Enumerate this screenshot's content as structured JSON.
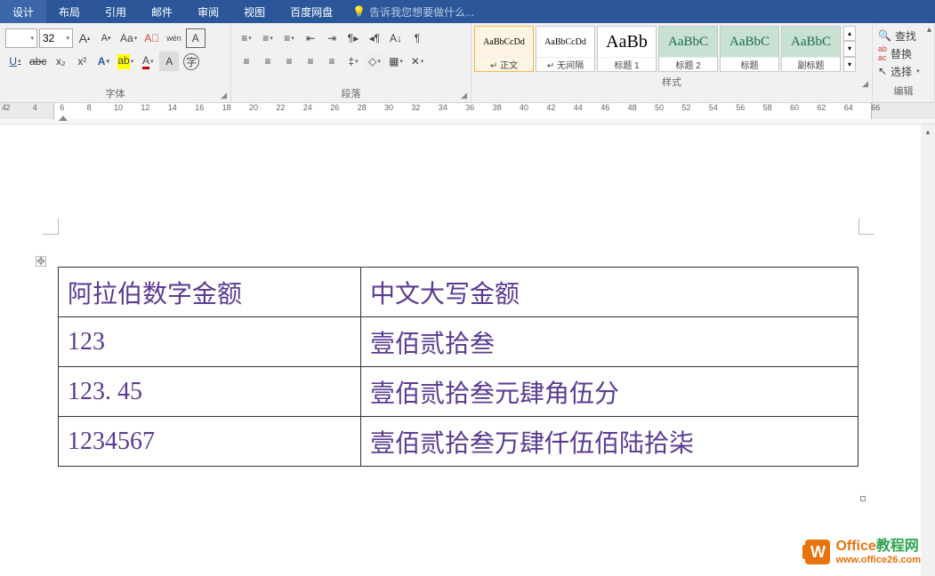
{
  "menu": {
    "tabs": [
      "设计",
      "布局",
      "引用",
      "邮件",
      "审阅",
      "视图",
      "百度网盘"
    ],
    "tell_me": "告诉我您想要做什么..."
  },
  "ribbon": {
    "font_size": "32",
    "buttons": {
      "grow": "A",
      "shrink": "A",
      "case": "Aa",
      "clear": "A",
      "phonetic": "wén",
      "charborder": "A",
      "underline": "U",
      "strike": "abc",
      "sub": "x₂",
      "sup": "x²",
      "texteffects": "A",
      "highlight": "ab",
      "fontcolor": "A",
      "charshade": "A",
      "enclose": "字"
    },
    "font_group_label": "字体",
    "para_group_label": "段落",
    "styles": [
      {
        "preview": "AaBbCcDd",
        "name": "↵ 正文",
        "sel": true,
        "teal": false,
        "size": "10px"
      },
      {
        "preview": "AaBbCcDd",
        "name": "↵ 无间隔",
        "sel": false,
        "teal": false,
        "size": "10px"
      },
      {
        "preview": "AaBb",
        "name": "标题 1",
        "sel": false,
        "teal": false,
        "size": "20px"
      },
      {
        "preview": "AaBbC",
        "name": "标题 2",
        "sel": false,
        "teal": true,
        "size": "15px"
      },
      {
        "preview": "AaBbC",
        "name": "标题",
        "sel": false,
        "teal": true,
        "size": "15px"
      },
      {
        "preview": "AaBbC",
        "name": "副标题",
        "sel": false,
        "teal": true,
        "size": "15px"
      }
    ],
    "style_group_label": "样式",
    "edit": {
      "find": "查找",
      "replace": "替换",
      "select": "选择",
      "label": "编辑"
    }
  },
  "ruler_white_start": 60,
  "table": {
    "rows": [
      {
        "c1": "阿拉伯数字金额",
        "c2": "中文大写金额"
      },
      {
        "c1": "123",
        "c2": "壹佰贰拾叁"
      },
      {
        "c1": "123. 45",
        "c2": "壹佰贰拾叁元肆角伍分"
      },
      {
        "c1": "1234567",
        "c2": "壹佰贰拾叁万肆仟伍佰陆拾柒"
      }
    ]
  },
  "watermark": {
    "brand_a": "Office",
    "brand_b": "教程网",
    "url": "www.office26.com"
  }
}
